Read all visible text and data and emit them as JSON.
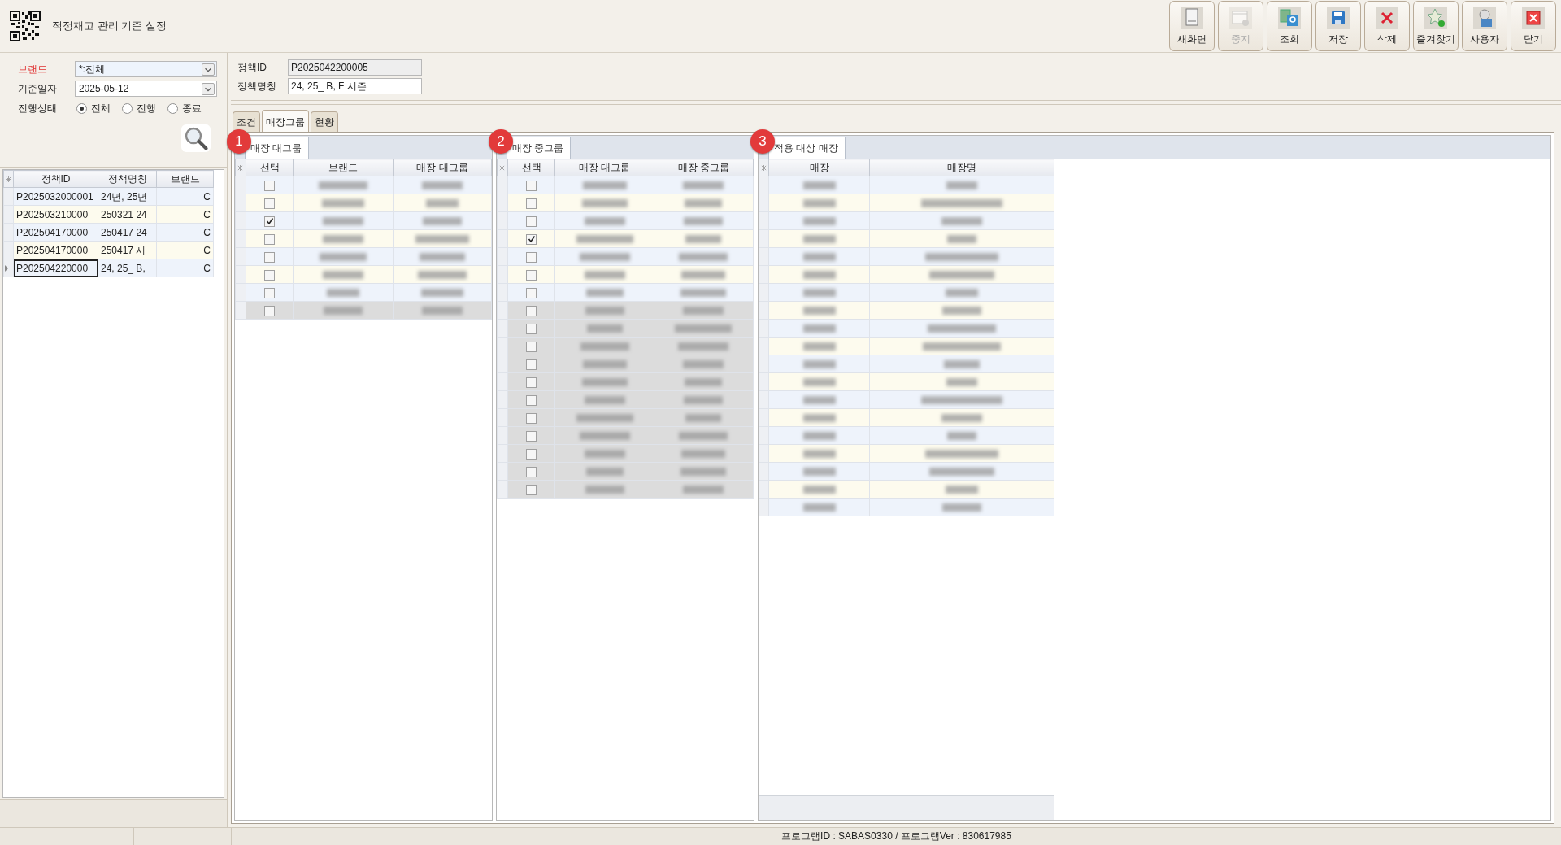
{
  "window": {
    "title": "적정재고 관리 기준 설정"
  },
  "toolbar": [
    {
      "label": "새화면",
      "kind": "new",
      "disabled": false
    },
    {
      "label": "중지",
      "kind": "stop",
      "disabled": true
    },
    {
      "label": "조회",
      "kind": "search",
      "disabled": false
    },
    {
      "label": "저장",
      "kind": "save",
      "disabled": false
    },
    {
      "label": "삭제",
      "kind": "delete",
      "disabled": false
    },
    {
      "label": "즐겨찾기",
      "kind": "favorite",
      "disabled": false
    },
    {
      "label": "사용자",
      "kind": "user",
      "disabled": false
    },
    {
      "label": "닫기",
      "kind": "close",
      "disabled": false
    }
  ],
  "filters": {
    "brand": {
      "label": "브랜드",
      "value": "*:전체"
    },
    "date": {
      "label": "기준일자",
      "value": "2025-05-12"
    },
    "status": {
      "label": "진행상태",
      "options": [
        {
          "label": "전체",
          "selected": true
        },
        {
          "label": "진행",
          "selected": false
        },
        {
          "label": "종료",
          "selected": false
        }
      ]
    }
  },
  "policy_list": {
    "columns": [
      "정책ID",
      "정책명칭",
      "브랜드"
    ],
    "rows": [
      {
        "cells": [
          "P2025032000001",
          "24년, 25년",
          "C"
        ],
        "selected": false
      },
      {
        "cells": [
          "P202503210000",
          "250321 24",
          "C"
        ],
        "selected": false
      },
      {
        "cells": [
          "P202504170000",
          "250417 24",
          "C"
        ],
        "selected": false
      },
      {
        "cells": [
          "P202504170000",
          "250417 시",
          "C"
        ],
        "selected": false
      },
      {
        "cells": [
          "P202504220000",
          "24, 25_ B,",
          "C"
        ],
        "selected": true
      }
    ]
  },
  "policy": {
    "id": {
      "label": "정책ID",
      "value": "P2025042200005",
      "readonly": true
    },
    "name": {
      "label": "정책명칭",
      "value": "24, 25_ B, F 시즌",
      "readonly": false
    }
  },
  "tabs": [
    {
      "label": "조건",
      "selected": false
    },
    {
      "label": "매장그룹",
      "selected": true
    },
    {
      "label": "현황",
      "selected": false
    }
  ],
  "panels": [
    {
      "badge": "1",
      "title": "매장 대그룹",
      "columns": [
        "선택",
        "브랜드",
        "매장 대그룹"
      ],
      "rows": [
        {
          "kind": "checkbox",
          "checked": false,
          "selected": false
        },
        {
          "kind": "checkbox",
          "checked": false,
          "selected": false
        },
        {
          "kind": "checkbox",
          "checked": true,
          "selected": false
        },
        {
          "kind": "checkbox",
          "checked": false,
          "selected": false
        },
        {
          "kind": "checkbox",
          "checked": false,
          "selected": false
        },
        {
          "kind": "checkbox",
          "checked": false,
          "selected": false
        },
        {
          "kind": "checkbox",
          "checked": false,
          "selected": false
        },
        {
          "kind": "checkbox",
          "checked": false,
          "selected": true
        }
      ]
    },
    {
      "badge": "2",
      "title": "매장 중그룹",
      "columns": [
        "선택",
        "매장 대그룹",
        "매장 중그룹"
      ],
      "rows": [
        {
          "kind": "checkbox",
          "checked": false,
          "selected": false
        },
        {
          "kind": "checkbox",
          "checked": false,
          "selected": false
        },
        {
          "kind": "checkbox",
          "checked": false,
          "selected": false
        },
        {
          "kind": "checkbox",
          "checked": true,
          "selected": false
        },
        {
          "kind": "checkbox",
          "checked": false,
          "selected": false
        },
        {
          "kind": "checkbox",
          "checked": false,
          "selected": false
        },
        {
          "kind": "checkbox",
          "checked": false,
          "selected": false
        },
        {
          "kind": "checkbox",
          "checked": false,
          "selected": true
        },
        {
          "kind": "checkbox",
          "checked": false,
          "selected": true
        },
        {
          "kind": "checkbox",
          "checked": false,
          "selected": true
        },
        {
          "kind": "checkbox",
          "checked": false,
          "selected": true
        },
        {
          "kind": "checkbox",
          "checked": false,
          "selected": true
        },
        {
          "kind": "checkbox",
          "checked": false,
          "selected": true
        },
        {
          "kind": "checkbox",
          "checked": false,
          "selected": true
        },
        {
          "kind": "checkbox",
          "checked": false,
          "selected": true
        },
        {
          "kind": "checkbox",
          "checked": false,
          "selected": true
        },
        {
          "kind": "checkbox",
          "checked": false,
          "selected": true
        },
        {
          "kind": "checkbox",
          "checked": false,
          "selected": true
        }
      ]
    },
    {
      "badge": "3",
      "title": "적용 대상 매장",
      "columns": [
        "매장",
        "매장명"
      ],
      "rows": [
        {
          "kind": "plain",
          "selected": false
        },
        {
          "kind": "plain",
          "selected": false
        },
        {
          "kind": "plain",
          "selected": false
        },
        {
          "kind": "plain",
          "selected": false
        },
        {
          "kind": "plain",
          "selected": false
        },
        {
          "kind": "plain",
          "selected": false
        },
        {
          "kind": "plain",
          "selected": false
        },
        {
          "kind": "plain",
          "selected": false
        },
        {
          "kind": "plain",
          "selected": false
        },
        {
          "kind": "plain",
          "selected": false
        },
        {
          "kind": "plain",
          "selected": false
        },
        {
          "kind": "plain",
          "selected": false
        },
        {
          "kind": "plain",
          "selected": false
        },
        {
          "kind": "plain",
          "selected": false
        },
        {
          "kind": "plain",
          "selected": false
        },
        {
          "kind": "plain",
          "selected": false
        },
        {
          "kind": "plain",
          "selected": false
        },
        {
          "kind": "plain",
          "selected": false
        },
        {
          "kind": "plain",
          "selected": false
        }
      ]
    }
  ],
  "status_bar": {
    "text": "프로그램ID : SABAS0330 / 프로그램Ver : 830617985"
  }
}
